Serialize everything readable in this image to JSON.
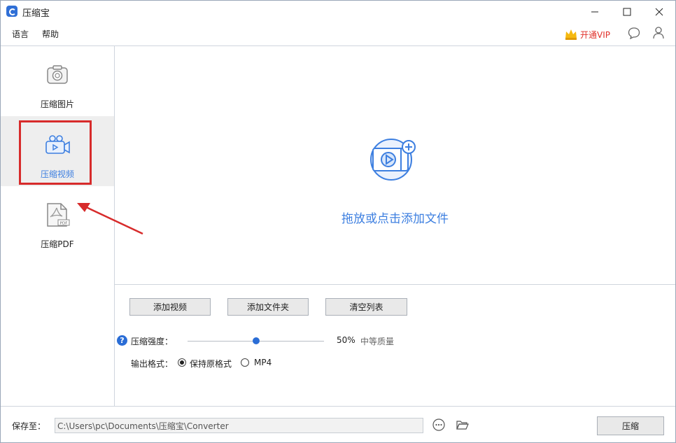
{
  "window": {
    "title": "压缩宝"
  },
  "menu": {
    "language": "语言",
    "help": "帮助"
  },
  "header": {
    "vip_label": "开通VIP"
  },
  "sidebar": {
    "items": [
      {
        "label": "压缩图片",
        "icon": "camera-icon"
      },
      {
        "label": "压缩视频",
        "icon": "video-camera-icon",
        "active": true
      },
      {
        "label": "压缩PDF",
        "icon": "pdf-file-icon"
      }
    ]
  },
  "drop_area": {
    "text": "拖放或点击添加文件",
    "icon": "add-video-icon"
  },
  "actions": {
    "add_video": "添加视频",
    "add_folder": "添加文件夹",
    "clear_list": "清空列表"
  },
  "compression": {
    "label": "压缩强度：",
    "value": 50,
    "value_text": "50%",
    "quality_text": "中等质量"
  },
  "output_format": {
    "label": "输出格式：",
    "options": [
      "保持原格式",
      "MP4"
    ],
    "selected": "保持原格式"
  },
  "save": {
    "label": "保存至：",
    "path": "C:\\Users\\pc\\Documents\\压缩宝\\Converter"
  },
  "compress_button": "压缩",
  "colors": {
    "accent": "#3d7fe0",
    "highlight": "#d72b2b",
    "vip": "#e0302a"
  }
}
